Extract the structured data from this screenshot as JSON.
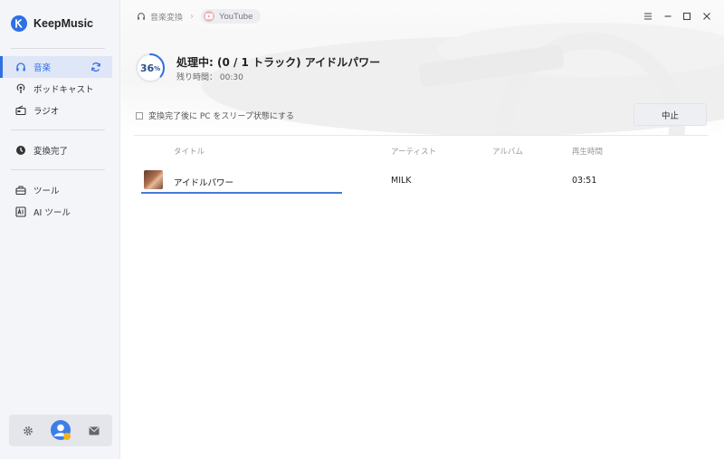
{
  "app": {
    "name": "KeepMusic"
  },
  "sidebar": {
    "items": [
      {
        "label": "音楽"
      },
      {
        "label": "ポッドキャスト"
      },
      {
        "label": "ラジオ"
      },
      {
        "label": "変換完了"
      },
      {
        "label": "ツール"
      },
      {
        "label": "AI ツール"
      }
    ]
  },
  "breadcrumb": {
    "section": "音楽変換",
    "source": "YouTube"
  },
  "conversion": {
    "percent_label": "36",
    "percent_value": 36,
    "title": "処理中: (0 / 1 トラック) アイドルパワー",
    "remaining": "残り時間： 00:30",
    "sleep_label": "変換完了後に PC をスリープ状態にする",
    "stop_label": "中止"
  },
  "table": {
    "columns": [
      "タイトル",
      "アーティスト",
      "アルバム",
      "再生時間"
    ],
    "rows": [
      {
        "title": "アイドルパワー",
        "artist": "MILK",
        "album": "",
        "duration": "03:51"
      }
    ]
  },
  "colors": {
    "accent": "#2f6fe6",
    "sidebar_bg": "#f4f5f8",
    "active_bg": "#dfe6f7"
  }
}
